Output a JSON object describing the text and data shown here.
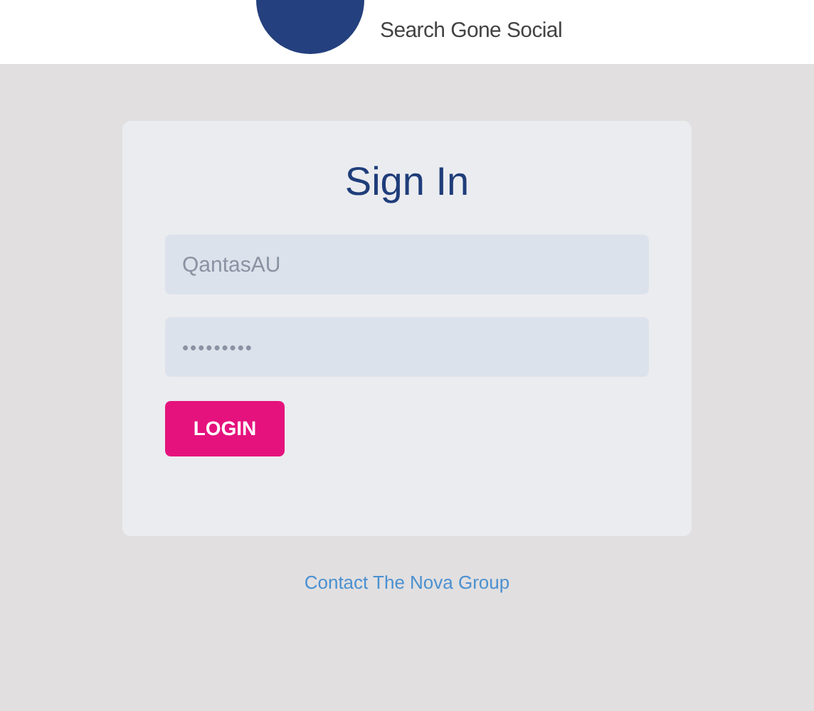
{
  "header": {
    "tagline": "Search Gone Social"
  },
  "form": {
    "title": "Sign In",
    "fields": [
      {
        "kind": "text",
        "value": "QantasAU"
      },
      {
        "kind": "password",
        "value": "•••••••••"
      }
    ],
    "button": "LOGIN"
  },
  "footer_link": "Contact The Nova Group"
}
